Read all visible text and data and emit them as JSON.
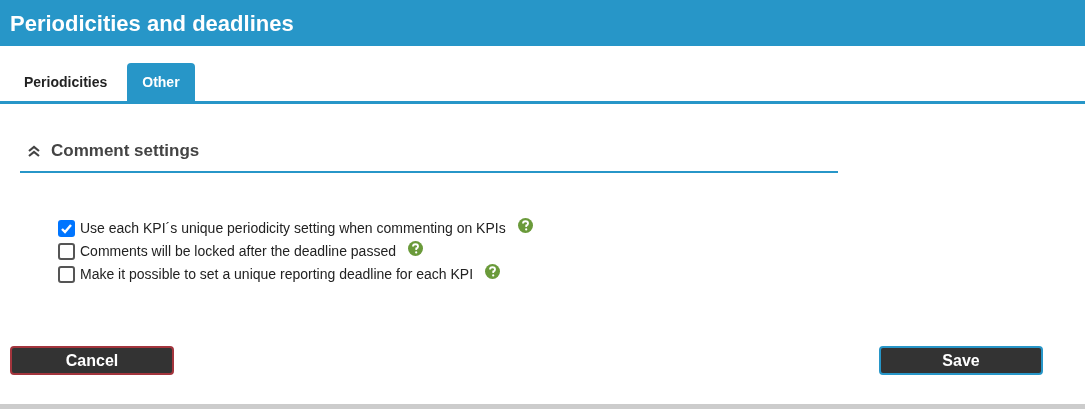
{
  "header": {
    "title": "Periodicities and deadlines"
  },
  "tabs": [
    {
      "label": "Periodicities",
      "selected": false
    },
    {
      "label": "Other",
      "selected": true
    }
  ],
  "section": {
    "title": "Comment settings",
    "expanded": true
  },
  "options": [
    {
      "label": "Use each KPI´s unique periodicity setting when commenting on KPIs",
      "checked": true
    },
    {
      "label": "Comments will be locked after the deadline passed",
      "checked": false
    },
    {
      "label": "Make it possible to set a unique reporting deadline for each KPI",
      "checked": false
    }
  ],
  "buttons": [
    {
      "label": "Cancel",
      "kind": "cancel"
    },
    {
      "label": "Save",
      "kind": "save"
    }
  ]
}
